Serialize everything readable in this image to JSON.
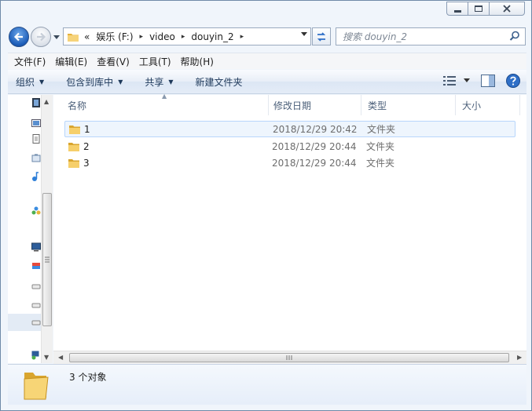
{
  "nav": {
    "address": {
      "overflow_glyph": "«",
      "segments": [
        "娱乐 (F:)",
        "video",
        "douyin_2"
      ],
      "separator": "▸"
    },
    "search_placeholder": "搜索 douyin_2"
  },
  "menubar": [
    {
      "label": "文件(F)"
    },
    {
      "label": "编辑(E)"
    },
    {
      "label": "查看(V)"
    },
    {
      "label": "工具(T)"
    },
    {
      "label": "帮助(H)"
    }
  ],
  "toolbar": {
    "organize": "组织",
    "include_in_library": "包含到库中",
    "share": "共享",
    "new_folder": "新建文件夹"
  },
  "columns": {
    "name": "名称",
    "date_modified": "修改日期",
    "type": "类型",
    "size": "大小"
  },
  "files": [
    {
      "name": "1",
      "date": "2018/12/29 20:42",
      "type": "文件夹"
    },
    {
      "name": "2",
      "date": "2018/12/29 20:44",
      "type": "文件夹"
    },
    {
      "name": "3",
      "date": "2018/12/29 20:44",
      "type": "文件夹"
    }
  ],
  "status": {
    "item_count": "3 个对象"
  },
  "colors": {
    "accent": "#1b5cb8",
    "folder": "#f2c14e",
    "selected_row": "#eef5fd"
  }
}
